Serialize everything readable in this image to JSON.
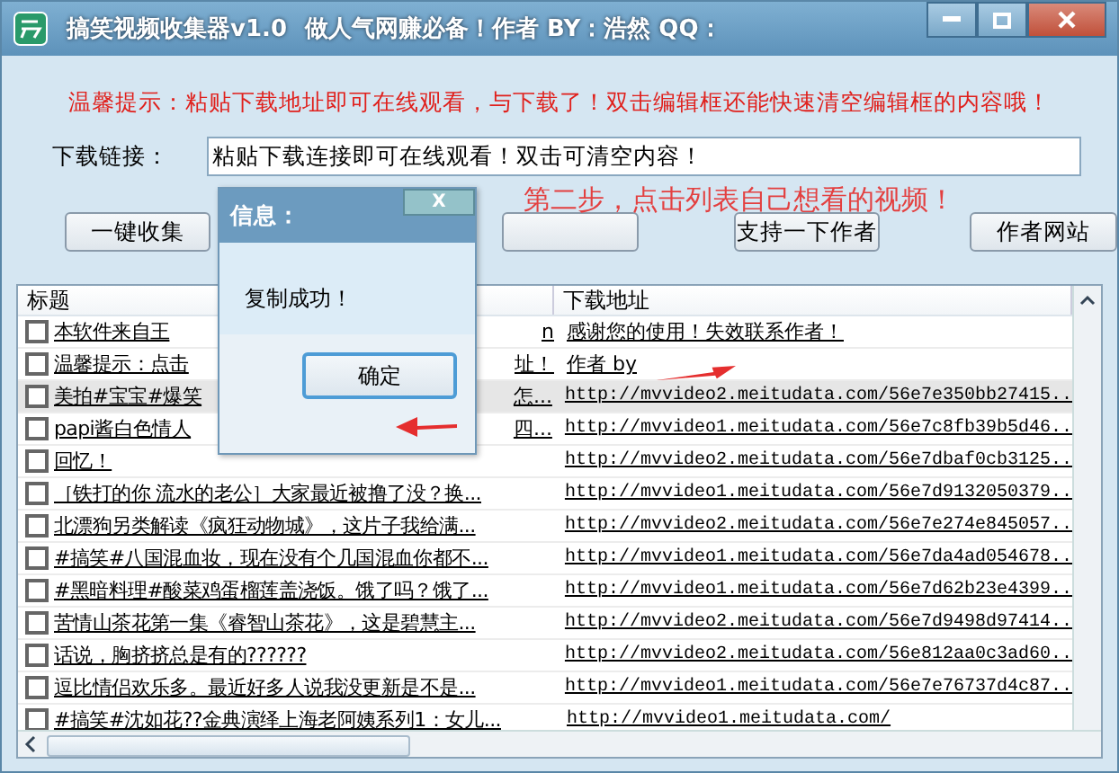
{
  "window": {
    "title": "搞笑视频收集器v1.0",
    "subtitle": "做人气网赚必备！作者  BY：浩然  QQ："
  },
  "hint": "温馨提示：粘贴下载地址即可在线观看，与下载了！双击编辑框还能快速清空编辑框的内容哦！",
  "link_field": {
    "label": "下载链接：",
    "value": "粘贴下载连接即可在线观看！双击可清空内容！"
  },
  "buttons": [
    {
      "label": "一键收集"
    },
    {
      "label": "支持一下作者"
    },
    {
      "label": "作者网站"
    }
  ],
  "annotation": "第二步，点击列表自己想看的视频！",
  "table": {
    "columns": [
      "标题",
      "下载地址"
    ],
    "rows": [
      {
        "checked": false,
        "selected": false,
        "title": "本软件来自王",
        "title_end": "n",
        "url": "感谢您的使用！失效联系作者！"
      },
      {
        "checked": false,
        "selected": false,
        "title": "温馨提示：点击",
        "title_end": "址！",
        "url": "作者 by"
      },
      {
        "checked": false,
        "selected": true,
        "title": "美拍#宝宝#爆笑",
        "title_end": "怎...",
        "url": "http://mvvideo2.meitudata.com/56e7e350bb27415.."
      },
      {
        "checked": false,
        "selected": false,
        "title": "papi酱白色情人",
        "title_end": "四...",
        "url": "http://mvvideo1.meitudata.com/56e7c8fb39b5d46.."
      },
      {
        "checked": false,
        "selected": false,
        "title": "回忆！",
        "url": "http://mvvideo2.meitudata.com/56e7dbaf0cb3125.."
      },
      {
        "checked": false,
        "selected": false,
        "title": "［铁打的你 流水的老公］大家最近被撸了没？换...",
        "url": "http://mvvideo1.meitudata.com/56e7d9132050379.."
      },
      {
        "checked": false,
        "selected": false,
        "title": "北漂狗另类解读《疯狂动物城》，这片子我给满...",
        "url": "http://mvvideo2.meitudata.com/56e7e274e845057.."
      },
      {
        "checked": false,
        "selected": false,
        "title": "#搞笑#八国混血妆，现在没有个几国混血你都不...",
        "url": "http://mvvideo1.meitudata.com/56e7da4ad054678.."
      },
      {
        "checked": false,
        "selected": false,
        "title": "#黑暗料理#酸菜鸡蛋榴莲盖浇饭。饿了吗？饿了...",
        "url": "http://mvvideo1.meitudata.com/56e7d62b23e4399.."
      },
      {
        "checked": false,
        "selected": false,
        "title": "苦情山茶花第一集《睿智山茶花》，这是碧慧主...",
        "url": "http://mvvideo2.meitudata.com/56e7d9498d97414.."
      },
      {
        "checked": false,
        "selected": false,
        "title": "话说，胸挤挤总是有的??????",
        "url": "http://mvvideo2.meitudata.com/56e812aa0c3ad60.."
      },
      {
        "checked": false,
        "selected": false,
        "title": "逗比情侣欢乐多。最近好多人说我没更新是不是...",
        "url": "http://mvvideo1.meitudata.com/56e7e76737d4c87.."
      },
      {
        "checked": false,
        "selected": false,
        "title": "#搞笑#沈如花??金典演绎上海老阿姨系列1：女儿...",
        "url": "http://mvvideo1.meitudata.com/"
      }
    ]
  },
  "dialog": {
    "title": "信息：",
    "close": "X",
    "message": "复制成功！",
    "button": "确定"
  }
}
